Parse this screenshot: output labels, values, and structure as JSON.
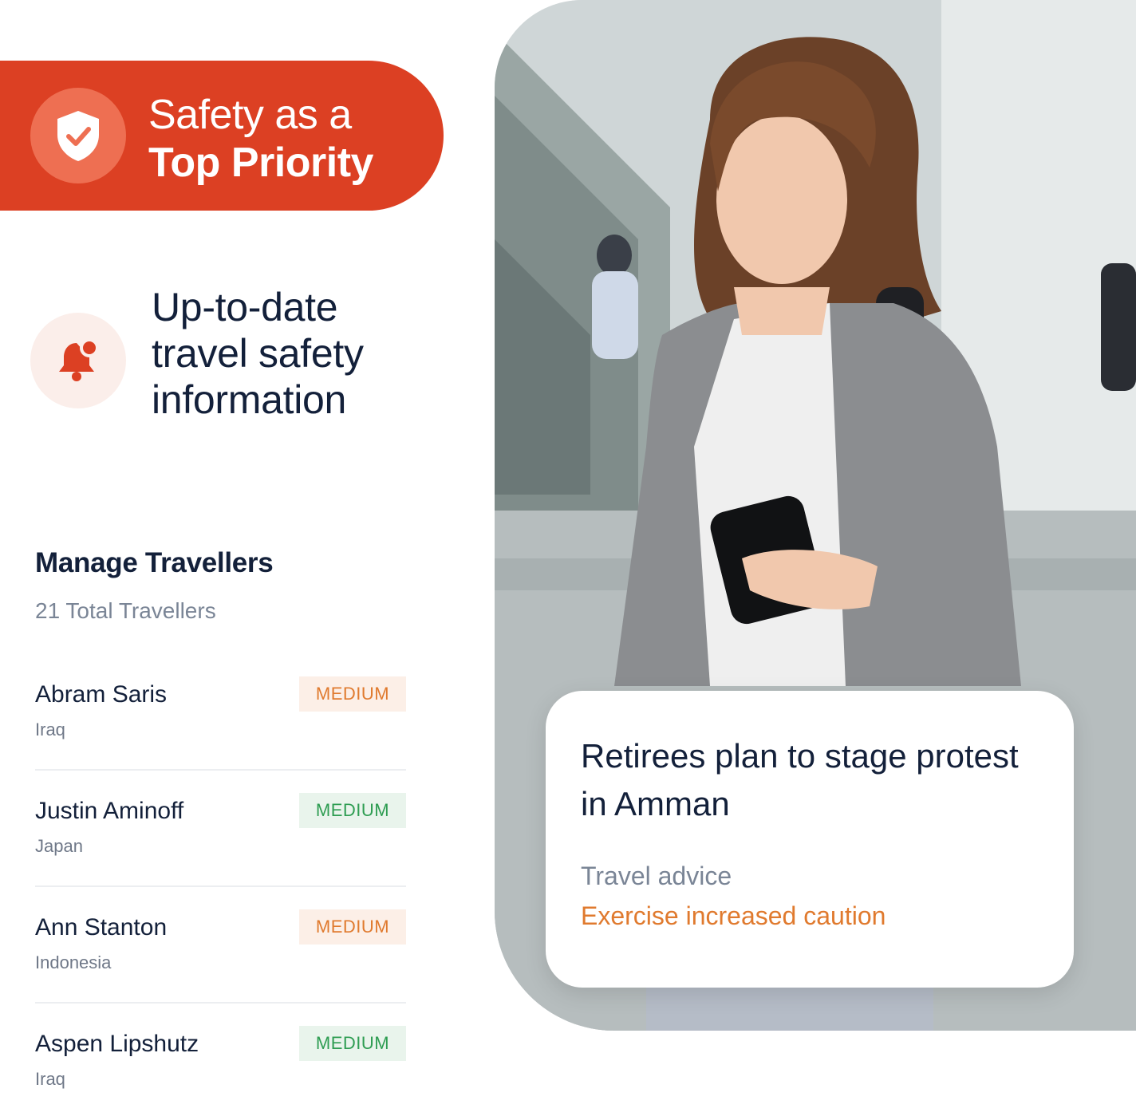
{
  "safety": {
    "line1": "Safety as a",
    "line2": "Top Priority",
    "icon": "shield-check-icon"
  },
  "alert": {
    "lines": [
      "Up-to-date",
      "travel safety",
      "information"
    ],
    "icon": "bell-alert-icon"
  },
  "travellers": {
    "title": "Manage Travellers",
    "subtitle": "21 Total Travellers",
    "rows": [
      {
        "name": "Abram Saris",
        "country": "Iraq",
        "level": "MEDIUM",
        "color": "orange"
      },
      {
        "name": "Justin Aminoff",
        "country": "Japan",
        "level": "MEDIUM",
        "color": "green"
      },
      {
        "name": "Ann Stanton",
        "country": "Indonesia",
        "level": "MEDIUM",
        "color": "orange"
      },
      {
        "name": "Aspen Lipshutz",
        "country": "Iraq",
        "level": "MEDIUM",
        "color": "green"
      }
    ]
  },
  "news": {
    "headline": "Retirees plan to stage protest in Amman",
    "advice_label": "Travel advice",
    "advice_value": "Exercise increased caution"
  },
  "colors": {
    "brand": "#dc4023",
    "orange": "#e07a2e",
    "green": "#2e9d52",
    "text": "#13203a"
  }
}
